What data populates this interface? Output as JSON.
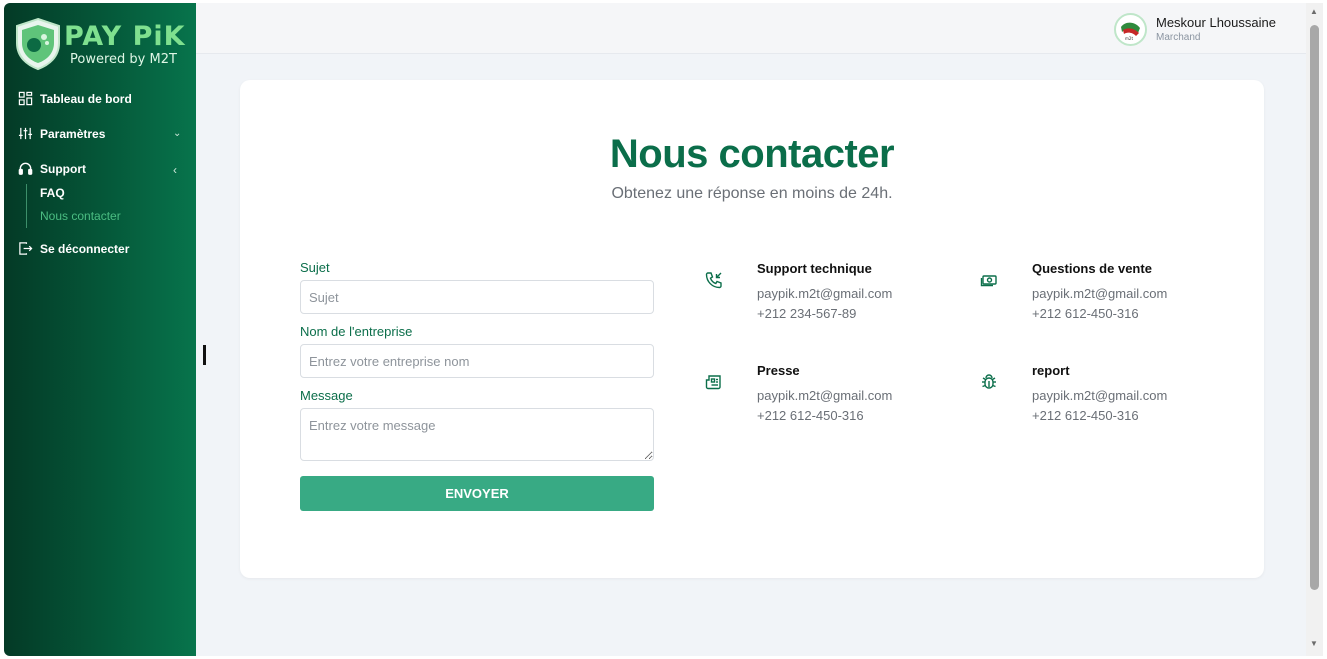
{
  "brand": {
    "name": "PAY PiK",
    "powered_by": "Powered by M2T"
  },
  "sidebar": {
    "items": [
      {
        "label": "Tableau de bord",
        "icon": "grid-icon"
      },
      {
        "label": "Paramètres",
        "icon": "sliders-icon"
      },
      {
        "label": "Support",
        "icon": "headphones-icon"
      },
      {
        "label": "Se déconnecter",
        "icon": "logout-icon"
      }
    ],
    "support_sub": [
      "FAQ",
      "Nous contacter"
    ]
  },
  "user": {
    "name": "Meskour Lhoussaine",
    "role": "Marchand"
  },
  "page": {
    "title": "Nous contacter",
    "subtitle": "Obtenez une réponse en moins de 24h."
  },
  "form": {
    "subject_label": "Sujet",
    "subject_placeholder": "Sujet",
    "company_label": "Nom de l'entreprise",
    "company_placeholder": "Entrez votre entreprise nom",
    "message_label": "Message",
    "message_placeholder": "Entrez votre message",
    "submit_label": "ENVOYER"
  },
  "contacts": [
    {
      "title": "Support technique",
      "email": "paypik.m2t@gmail.com",
      "phone": "+212 234-567-89",
      "icon": "phone-incoming-icon"
    },
    {
      "title": "Questions de vente",
      "email": "paypik.m2t@gmail.com",
      "phone": "+212 612-450-316",
      "icon": "cash-icon"
    },
    {
      "title": "Presse",
      "email": "paypik.m2t@gmail.com",
      "phone": "+212 612-450-316",
      "icon": "newspaper-icon"
    },
    {
      "title": "report",
      "email": "paypik.m2t@gmail.com",
      "phone": "+212 612-450-316",
      "icon": "bug-icon"
    }
  ],
  "colors": {
    "accent": "#0b6e4a",
    "button": "#38aa84",
    "sidebar_dark": "#043a26",
    "sidebar_light": "#07744c"
  }
}
